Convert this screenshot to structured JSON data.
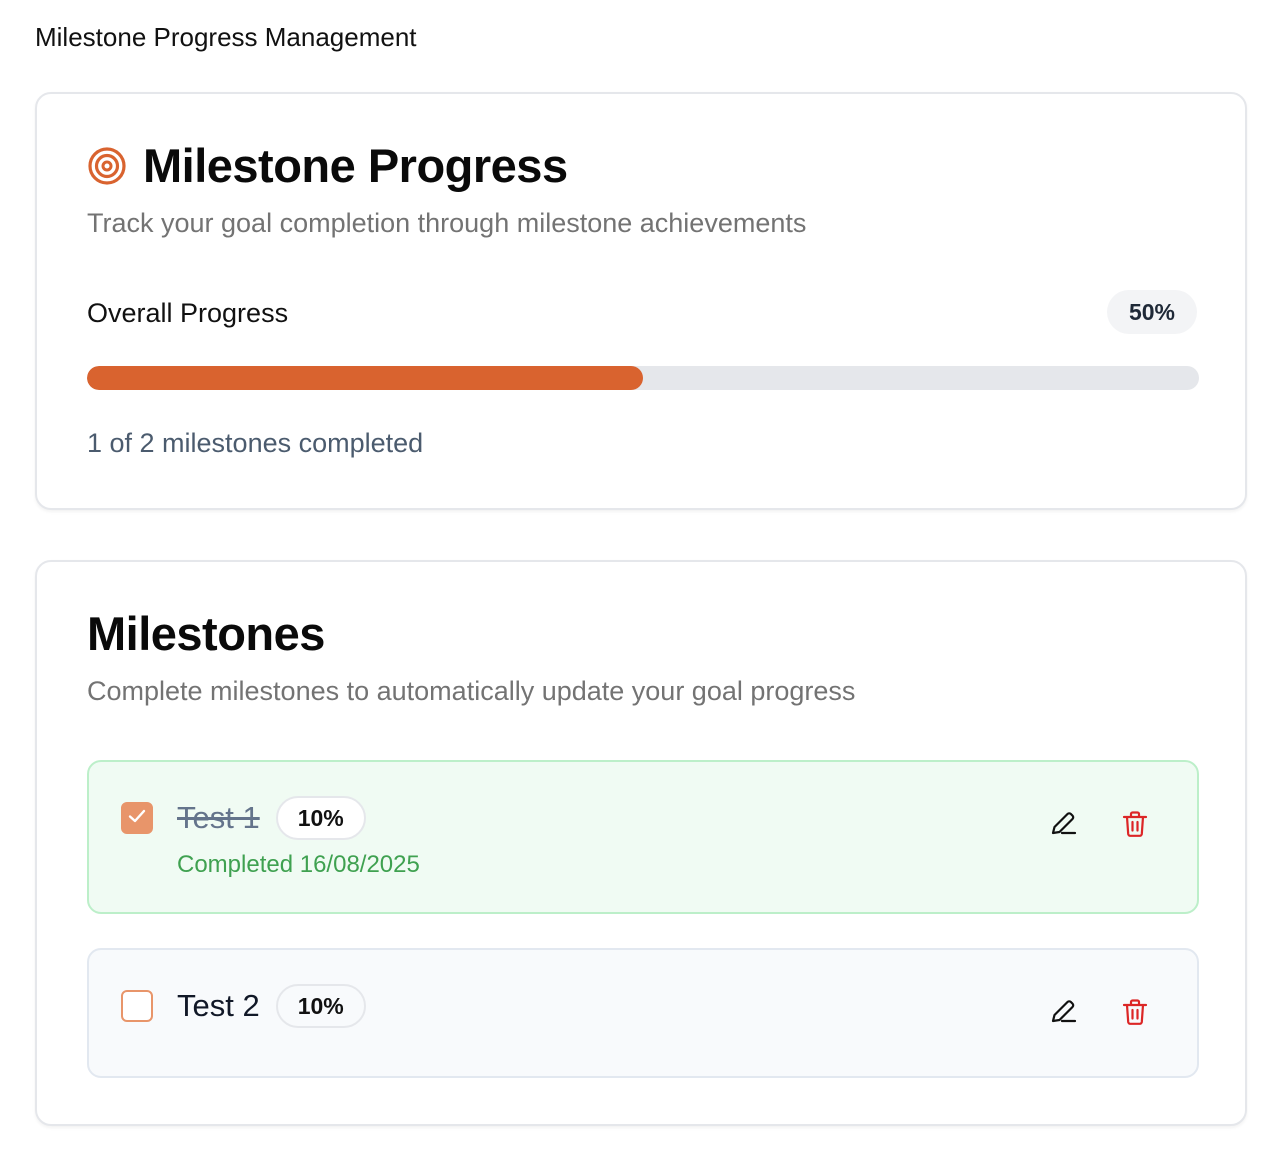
{
  "page": {
    "heading": "Milestone Progress Management"
  },
  "progress_card": {
    "icon": "target-icon",
    "title": "Milestone Progress",
    "description": "Track your goal completion through milestone achievements",
    "overall_label": "Overall Progress",
    "percent_label": "50%",
    "progress_fraction": 0.5,
    "caption": "1 of 2 milestones completed",
    "accent_color": "#d9632f"
  },
  "milestones_card": {
    "title": "Milestones",
    "description": "Complete milestones to automatically update your goal progress",
    "items": [
      {
        "name": "Test 1",
        "weight": "10%",
        "completed": true,
        "completed_text": "Completed 16/08/2025",
        "edit_icon": "pencil-icon",
        "delete_icon": "trash-icon"
      },
      {
        "name": "Test 2",
        "weight": "10%",
        "completed": false,
        "edit_icon": "pencil-icon",
        "delete_icon": "trash-icon"
      }
    ]
  },
  "colors": {
    "completed_bg": "#f0fbf3",
    "completed_text": "#3fa150",
    "delete": "#dc2626",
    "checkbox": "#e8956a"
  }
}
